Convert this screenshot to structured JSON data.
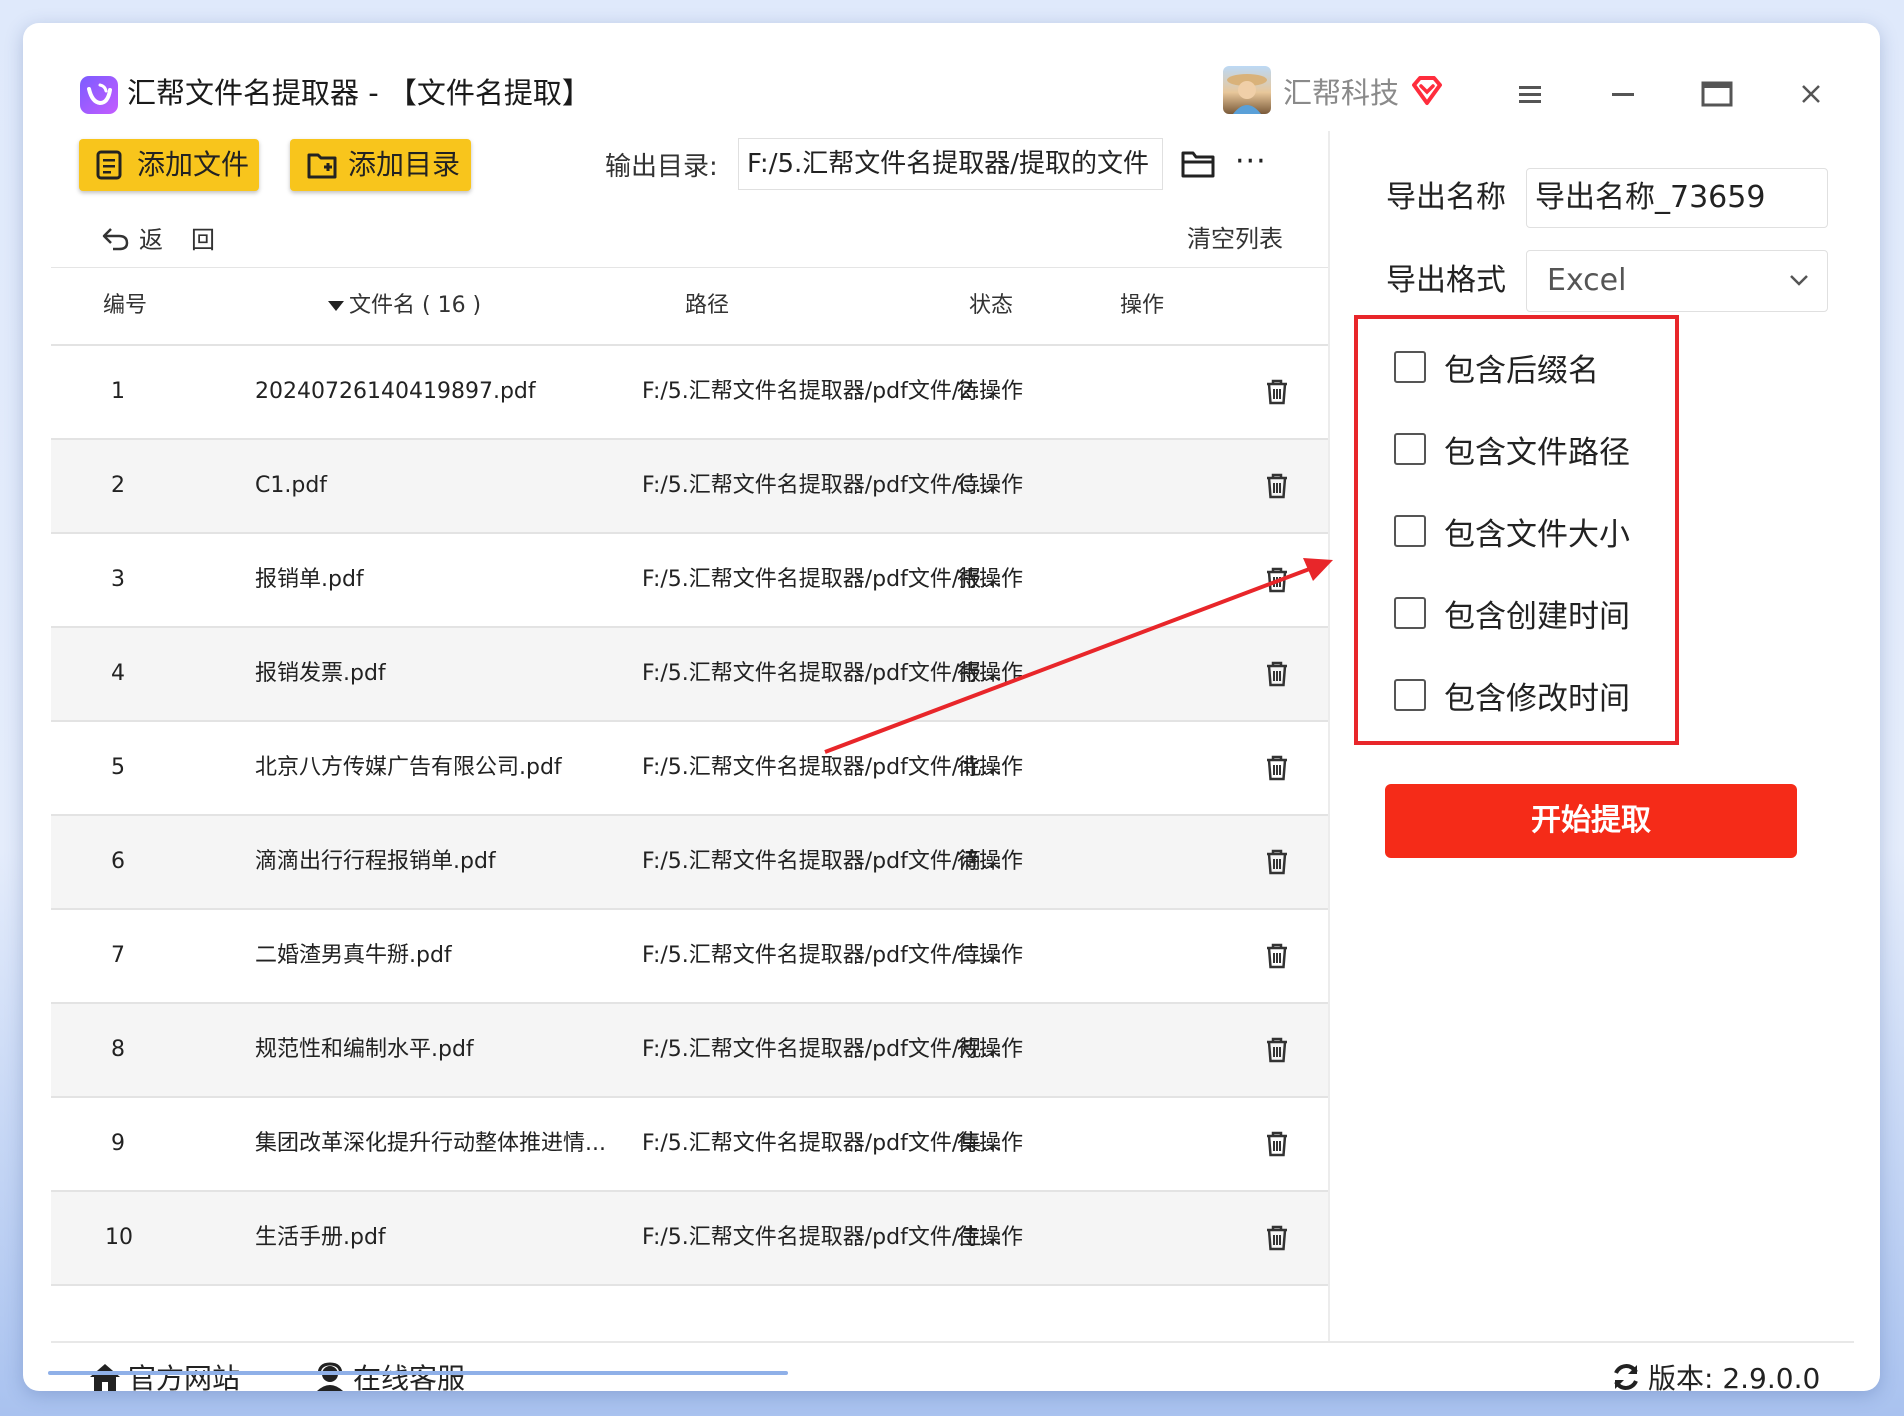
{
  "app": {
    "title": "汇帮文件名提取器 - 【文件名提取】",
    "brand": "汇帮科技"
  },
  "toolbar": {
    "add_file": "添加文件",
    "add_folder": "添加目录",
    "output_label": "输出目录:",
    "output_path": "F:/5.汇帮文件名提取器/提取的文件",
    "more": "···",
    "back": "返回",
    "clear": "清空列表"
  },
  "table": {
    "headers": {
      "index": "编号",
      "name": "文件名 ( 16 )",
      "path": "路径",
      "status": "状态",
      "action": "操作"
    },
    "rows": [
      {
        "index": "1",
        "name": "20240726140419897.pdf",
        "path": "F:/5.汇帮文件名提取器/pdf文件/2...",
        "status": "待操作"
      },
      {
        "index": "2",
        "name": "C1.pdf",
        "path": "F:/5.汇帮文件名提取器/pdf文件/C...",
        "status": "待操作"
      },
      {
        "index": "3",
        "name": "报销单.pdf",
        "path": "F:/5.汇帮文件名提取器/pdf文件/报...",
        "status": "待操作"
      },
      {
        "index": "4",
        "name": "报销发票.pdf",
        "path": "F:/5.汇帮文件名提取器/pdf文件/报...",
        "status": "待操作"
      },
      {
        "index": "5",
        "name": "北京八方传媒广告有限公司.pdf",
        "path": "F:/5.汇帮文件名提取器/pdf文件/北...",
        "status": "待操作"
      },
      {
        "index": "6",
        "name": "滴滴出行行程报销单.pdf",
        "path": "F:/5.汇帮文件名提取器/pdf文件/滴...",
        "status": "待操作"
      },
      {
        "index": "7",
        "name": "二婚渣男真牛掰.pdf",
        "path": "F:/5.汇帮文件名提取器/pdf文件/二...",
        "status": "待操作"
      },
      {
        "index": "8",
        "name": "规范性和编制水平.pdf",
        "path": "F:/5.汇帮文件名提取器/pdf文件/规...",
        "status": "待操作"
      },
      {
        "index": "9",
        "name": "集团改革深化提升行动整体推进情...",
        "path": "F:/5.汇帮文件名提取器/pdf文件/集...",
        "status": "待操作"
      },
      {
        "index": "10",
        "name": "生活手册.pdf",
        "path": "F:/5.汇帮文件名提取器/pdf文件/生...",
        "status": "待操作"
      }
    ]
  },
  "panel": {
    "export_name_label": "导出名称",
    "export_name_value": "导出名称_73659",
    "export_format_label": "导出格式",
    "export_format_value": "Excel",
    "options": [
      {
        "label": "包含后缀名",
        "checked": false
      },
      {
        "label": "包含文件路径",
        "checked": false
      },
      {
        "label": "包含文件大小",
        "checked": false
      },
      {
        "label": "包含创建时间",
        "checked": false
      },
      {
        "label": "包含修改时间",
        "checked": false
      }
    ],
    "start": "开始提取"
  },
  "footer": {
    "website": "官方网站",
    "support": "在线客服",
    "version": "版本: 2.9.0.0"
  },
  "colors": {
    "accent_yellow": "#f8c51c",
    "start_red": "#f52b18",
    "annotation_red": "#e8262a"
  }
}
